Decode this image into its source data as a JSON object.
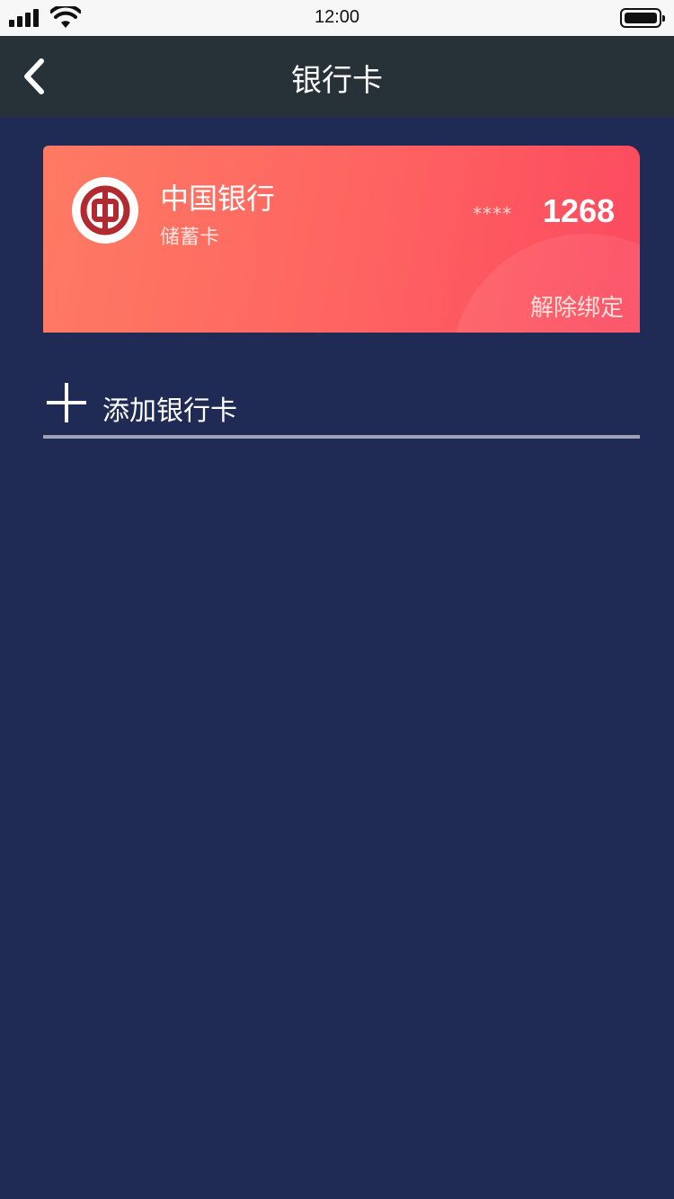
{
  "status_bar": {
    "time": "12:00",
    "signal_icon": "cellular-signal-icon",
    "wifi_icon": "wifi-icon",
    "battery_icon": "battery-full-icon"
  },
  "nav": {
    "back_icon": "chevron-left-icon",
    "title": "银行卡"
  },
  "bank_card": {
    "logo_icon": "bank-of-china-logo",
    "bank_name": "中国银行",
    "card_type": "储蓄卡",
    "masked": "****",
    "last4": "1268",
    "unbind_label": "解除绑定",
    "gradient_start": "#fe7b63",
    "gradient_end": "#fc4a60"
  },
  "add_card": {
    "icon": "plus-icon",
    "label": "添加银行卡"
  },
  "colors": {
    "background": "#1f2a55",
    "nav_bar": "#263138",
    "divider": "#9fa2b4"
  }
}
